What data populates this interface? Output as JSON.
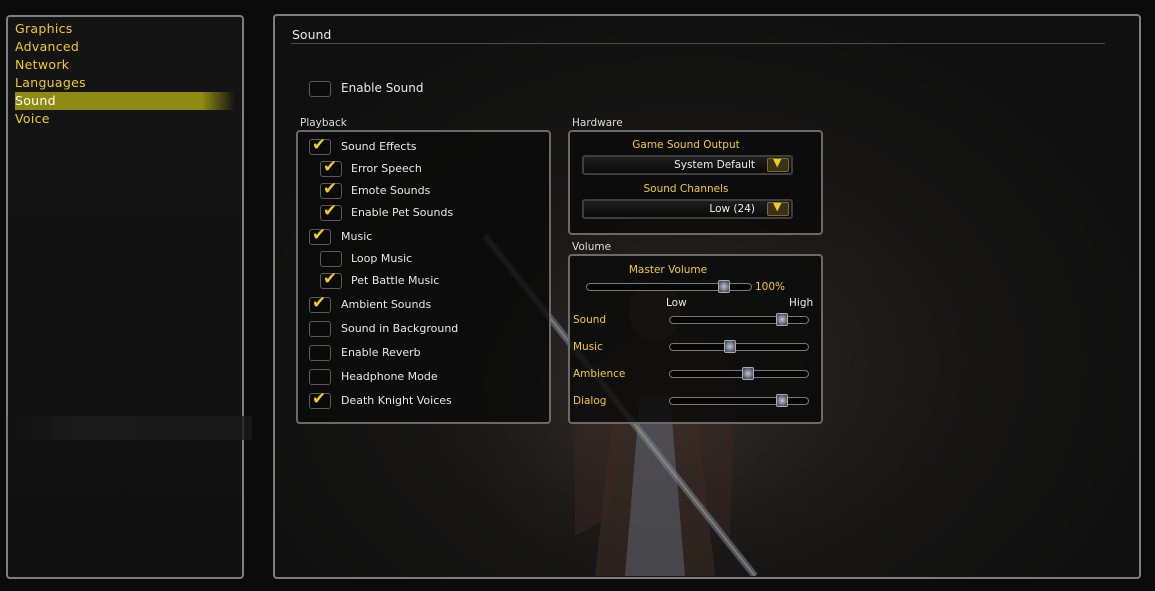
{
  "categories": [
    {
      "label": "Graphics",
      "selected": false
    },
    {
      "label": "Advanced",
      "selected": false
    },
    {
      "label": "Network",
      "selected": false
    },
    {
      "label": "Languages",
      "selected": false
    },
    {
      "label": "Sound",
      "selected": true
    },
    {
      "label": "Voice",
      "selected": false
    }
  ],
  "page": {
    "title": "Sound"
  },
  "enable_sound": {
    "label": "Enable Sound",
    "checked": false
  },
  "playback": {
    "title": "Playback",
    "items": [
      {
        "label": "Sound Effects",
        "checked": true
      },
      {
        "label": "Error Speech",
        "checked": true
      },
      {
        "label": "Emote Sounds",
        "checked": true
      },
      {
        "label": "Enable Pet Sounds",
        "checked": true
      },
      {
        "label": "Music",
        "checked": true
      },
      {
        "label": "Loop Music",
        "checked": false
      },
      {
        "label": "Pet Battle Music",
        "checked": true
      },
      {
        "label": "Ambient Sounds",
        "checked": true
      },
      {
        "label": "Sound in Background",
        "checked": false
      },
      {
        "label": "Enable Reverb",
        "checked": false
      },
      {
        "label": "Headphone Mode",
        "checked": false
      },
      {
        "label": "Death Knight Voices",
        "checked": true
      }
    ]
  },
  "hardware": {
    "title": "Hardware",
    "output_label": "Game Sound Output",
    "output_value": "System Default",
    "channels_label": "Sound Channels",
    "channels_value": "Low (24)"
  },
  "volume": {
    "title": "Volume",
    "master_label": "Master Volume",
    "master_value_text": "100%",
    "master_level": 1.0,
    "low_label": "Low",
    "high_label": "High",
    "sliders": [
      {
        "label": "Sound",
        "level": 0.85
      },
      {
        "label": "Music",
        "level": 0.42
      },
      {
        "label": "Ambience",
        "level": 0.57
      },
      {
        "label": "Dialog",
        "level": 0.85
      }
    ]
  },
  "colors": {
    "accent": "#f2cb1f",
    "selected_bg": "#8f8b12"
  },
  "icons": {
    "check": "checkmark-icon",
    "dropdown": "chevron-down-icon"
  }
}
